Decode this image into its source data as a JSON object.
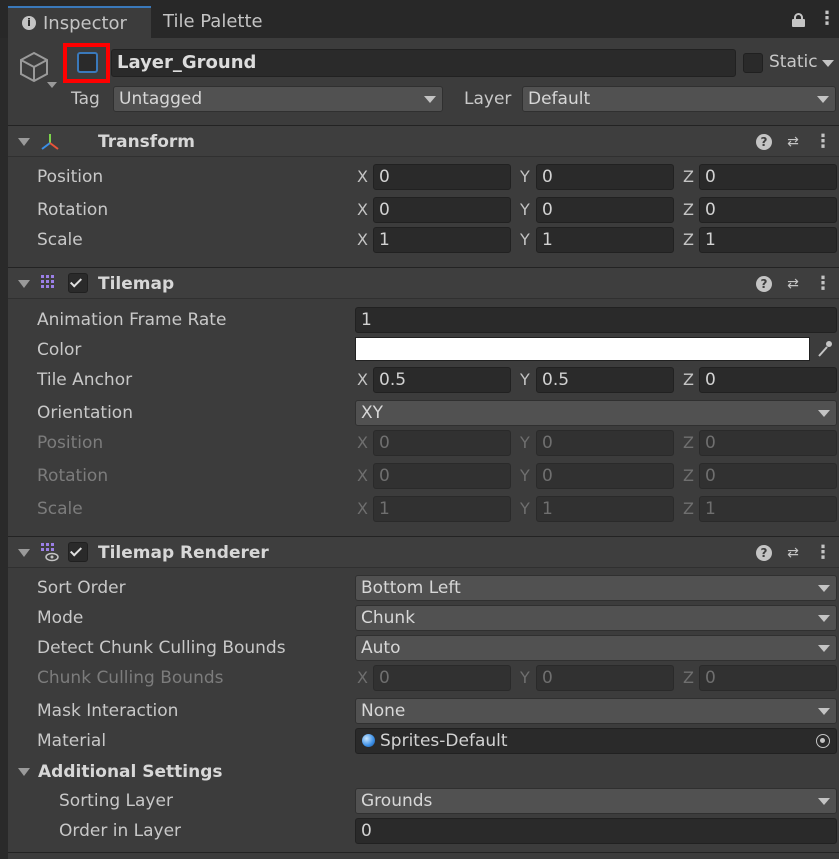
{
  "tabs": [
    {
      "label": "Inspector",
      "icon": "info-icon"
    },
    {
      "label": "Tile Palette"
    }
  ],
  "object": {
    "name": "Layer_Ground",
    "static_label": "Static",
    "tag_label": "Tag",
    "tag_value": "Untagged",
    "layer_label": "Layer",
    "layer_value": "Default"
  },
  "transform": {
    "title": "Transform",
    "position": {
      "label": "Position",
      "x": "0",
      "y": "0",
      "z": "0"
    },
    "rotation": {
      "label": "Rotation",
      "x": "0",
      "y": "0",
      "z": "0"
    },
    "scale": {
      "label": "Scale",
      "x": "1",
      "y": "1",
      "z": "1"
    }
  },
  "tilemap": {
    "title": "Tilemap",
    "anim_label": "Animation Frame Rate",
    "anim_value": "1",
    "color_label": "Color",
    "color_value": "#ffffff",
    "anchor_label": "Tile Anchor",
    "anchor": {
      "x": "0.5",
      "y": "0.5",
      "z": "0"
    },
    "orientation_label": "Orientation",
    "orientation_value": "XY",
    "position": {
      "label": "Position",
      "x": "0",
      "y": "0",
      "z": "0"
    },
    "rotation": {
      "label": "Rotation",
      "x": "0",
      "y": "0",
      "z": "0"
    },
    "scale": {
      "label": "Scale",
      "x": "1",
      "y": "1",
      "z": "1"
    }
  },
  "renderer": {
    "title": "Tilemap Renderer",
    "sort_order_label": "Sort Order",
    "sort_order_value": "Bottom Left",
    "mode_label": "Mode",
    "mode_value": "Chunk",
    "detect_label": "Detect Chunk Culling Bounds",
    "detect_value": "Auto",
    "bounds_label": "Chunk Culling Bounds",
    "bounds": {
      "x": "0",
      "y": "0",
      "z": "0"
    },
    "mask_label": "Mask Interaction",
    "mask_value": "None",
    "material_label": "Material",
    "material_value": "Sprites-Default",
    "additional_label": "Additional Settings",
    "sorting_layer_label": "Sorting Layer",
    "sorting_layer_value": "Grounds",
    "order_label": "Order in Layer",
    "order_value": "0"
  },
  "axes": {
    "x": "X",
    "y": "Y",
    "z": "Z"
  },
  "colors": {
    "highlight": "#ff0000",
    "accent": "#3a79bb"
  }
}
